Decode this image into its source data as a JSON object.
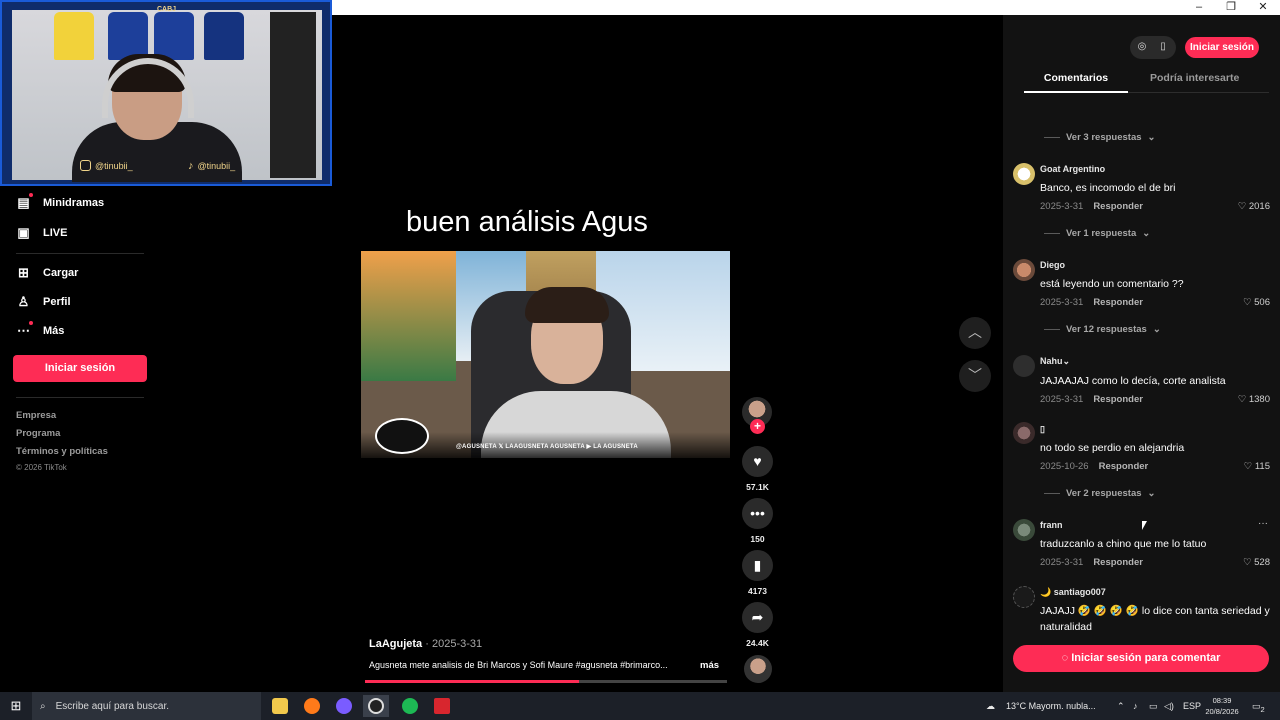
{
  "window": {
    "minimize": "–",
    "restore": "❐",
    "close": "✕"
  },
  "webcam": {
    "instagram_handle": "@tinubii_",
    "tiktok_handle": "@tinubii_",
    "jersey_badge": "CABJ"
  },
  "sidebar": {
    "items": [
      {
        "label": "Minidramas",
        "icon": "minidramas-icon"
      },
      {
        "label": "LIVE",
        "icon": "live-icon"
      },
      {
        "label": "Cargar",
        "icon": "upload-icon"
      },
      {
        "label": "Perfil",
        "icon": "profile-icon"
      },
      {
        "label": "Más",
        "icon": "more-dots-icon"
      }
    ],
    "login_label": "Iniciar sesión",
    "footer_links": [
      "Empresa",
      "Programa",
      "Términos y políticas"
    ],
    "copyright": "© 2026 TikTok"
  },
  "video": {
    "title_text": "buen análisis Agus",
    "banner_handles": "@AGUSNETA   𝕏 LAAGUSNETA   AGUSNETA   ▶ LA AGUSNETA",
    "author": "LaAgujeta",
    "date": "· 2025-3-31",
    "description": "Agusneta mete analisis de Bri Marcos y Sofi Maure #agusneta #brimarco...",
    "more_label": "más",
    "progress": 0.59,
    "accent_color": "#fe2c55"
  },
  "actions": {
    "follow_plus": "+",
    "likes": "57.1K",
    "comments": "150",
    "saves": "4173",
    "shares": "24.4K"
  },
  "panel": {
    "login_label": "Iniciar sesión",
    "tabs": [
      {
        "label": "Comentarios",
        "active": true
      },
      {
        "label": "Podría interesarte",
        "active": false
      }
    ],
    "reply_label": "Responder",
    "replies": [
      "Ver 3 respuestas",
      "Ver 1 respuesta",
      "Ver 12 respuestas",
      "Ver 2 respuestas"
    ],
    "comments": [
      {
        "user": "Goat Argentino",
        "text": "Banco, es incomodo el de bri",
        "date": "2025-3-31",
        "likes": "2016"
      },
      {
        "user": "Diego",
        "text": "está leyendo un comentario ??",
        "date": "2025-3-31",
        "likes": "506"
      },
      {
        "user": "Nahu⌄",
        "text": "JAJAAJAJ como lo decía, corte analista",
        "date": "2025-3-31",
        "likes": "1380"
      },
      {
        "user": "▯",
        "text": "no todo se perdio en alejandria",
        "date": "2025-10-26",
        "likes": "115"
      },
      {
        "user": "frann",
        "text": "traduzcanlo a chino que me lo tatuo",
        "date": "2025-3-31",
        "likes": "528"
      },
      {
        "user": "🌙 santiago007",
        "text": "JAJAJJ 🤣 🤣 🤣 🤣 lo dice con tanta seriedad y naturalidad",
        "date": "",
        "likes": ""
      }
    ],
    "comment_login_label": "Iniciar sesión para comentar"
  },
  "taskbar": {
    "search_placeholder": "Escribe aquí para buscar.",
    "weather": "13°C  Mayorm. nubla...",
    "language": "ESP",
    "time": "08:39",
    "date": "20/8/2026",
    "notifications": "2"
  }
}
